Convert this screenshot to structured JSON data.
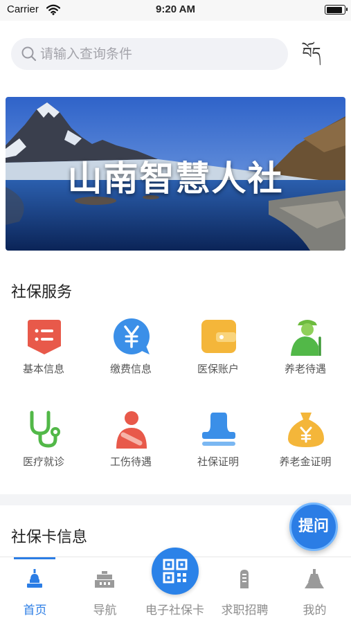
{
  "status_bar": {
    "carrier": "Carrier",
    "time": "9:20 AM",
    "battery_level": 0.95
  },
  "search": {
    "placeholder": "请输入查询条件"
  },
  "lang_switch": {
    "label": "བོད"
  },
  "banner": {
    "title": "山南智慧人社"
  },
  "social_services": {
    "title": "社保服务",
    "items": [
      {
        "label": "基本信息",
        "icon": "info-list-icon"
      },
      {
        "label": "缴费信息",
        "icon": "yuan-payment-icon"
      },
      {
        "label": "医保账户",
        "icon": "wallet-icon"
      },
      {
        "label": "养老待遇",
        "icon": "elderly-person-icon"
      },
      {
        "label": "医疗就诊",
        "icon": "stethoscope-icon"
      },
      {
        "label": "工伤待遇",
        "icon": "injured-person-icon"
      },
      {
        "label": "社保证明",
        "icon": "stamp-icon"
      },
      {
        "label": "养老金证明",
        "icon": "money-bag-icon"
      }
    ]
  },
  "card_info": {
    "title": "社保卡信息"
  },
  "ask_button": {
    "label": "提问"
  },
  "tabbar": {
    "active": 0,
    "tabs": [
      {
        "label": "首页",
        "icon": "home-stupa-icon"
      },
      {
        "label": "导航",
        "icon": "palace-icon"
      },
      {
        "label": "电子社保卡",
        "icon": "qr-code-icon"
      },
      {
        "label": "求职招聘",
        "icon": "stone-tablet-icon"
      },
      {
        "label": "我的",
        "icon": "mountain-temple-icon"
      }
    ]
  },
  "colors": {
    "accent": "#2b7de5",
    "info_red": "#e8594a",
    "payment_blue": "#3b8fe8",
    "wallet_yellow": "#f4b63a",
    "pension_green": "#52b848"
  }
}
